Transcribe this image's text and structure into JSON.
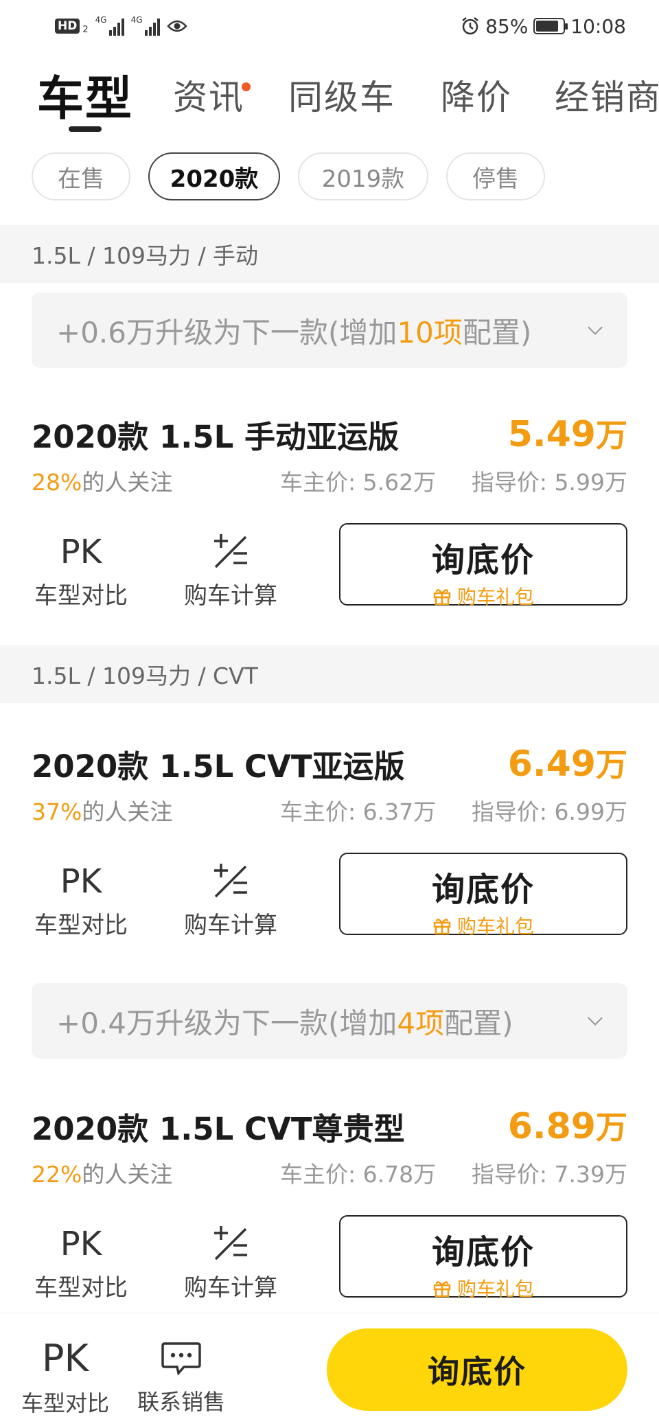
{
  "status_bar": {
    "hd_label": "HD",
    "hd_sub": "2",
    "signal1_label": "4G",
    "signal2_label": "4G",
    "battery": "85%",
    "battery_level": 0.85,
    "time": "10:08"
  },
  "tabs": [
    {
      "label": "车型",
      "active": true
    },
    {
      "label": "资讯",
      "active": false,
      "badge": true
    },
    {
      "label": "同级车",
      "active": false
    },
    {
      "label": "降价",
      "active": false
    },
    {
      "label": "经销商",
      "active": false
    }
  ],
  "filters": [
    {
      "label": "在售",
      "active": false
    },
    {
      "label": "2020款",
      "active": true
    },
    {
      "label": "2019款",
      "active": false
    },
    {
      "label": "停售",
      "active": false
    }
  ],
  "groups": [
    {
      "header": "1.5L / 109马力 / 手动"
    },
    {
      "header": "1.5L / 109马力 / CVT"
    }
  ],
  "upgrades": [
    {
      "pre": "+0.6万升级为下一款(增加",
      "count": "10项",
      "post": "配置)"
    },
    {
      "pre": "+0.4万升级为下一款(增加",
      "count": "4项",
      "post": "配置)"
    }
  ],
  "cars": [
    {
      "name": "2020款 1.5L 手动亚运版",
      "price": "5.49",
      "price_unit": "万",
      "attention_pct": "28%",
      "attention_text": "的人关注",
      "owner_price": "车主价: 5.62万",
      "guide_price": "指导价: 5.99万"
    },
    {
      "name": "2020款 1.5L CVT亚运版",
      "price": "6.49",
      "price_unit": "万",
      "attention_pct": "37%",
      "attention_text": "的人关注",
      "owner_price": "车主价: 6.37万",
      "guide_price": "指导价: 6.99万"
    },
    {
      "name": "2020款 1.5L CVT尊贵型",
      "price": "6.89",
      "price_unit": "万",
      "attention_pct": "22%",
      "attention_text": "的人关注",
      "owner_price": "车主价: 6.78万",
      "guide_price": "指导价: 7.39万"
    }
  ],
  "card_actions": {
    "compare_icon": "PK",
    "compare_label": "车型对比",
    "calc_label": "购车计算",
    "inquire_label": "询底价",
    "gift_label": "购车礼包"
  },
  "bottom_bar": {
    "compare_icon": "PK",
    "compare_label": "车型对比",
    "contact_label": "联系销售",
    "cta_label": "询底价"
  },
  "colors": {
    "accent_orange": "#f39c12",
    "cta_yellow": "#ffd60a",
    "badge_red": "#f05a28"
  },
  "icons": [
    "eye-icon",
    "alarm-icon",
    "battery-icon",
    "calculator-icon",
    "gift-icon",
    "chat-icon",
    "chevron-down-icon"
  ]
}
